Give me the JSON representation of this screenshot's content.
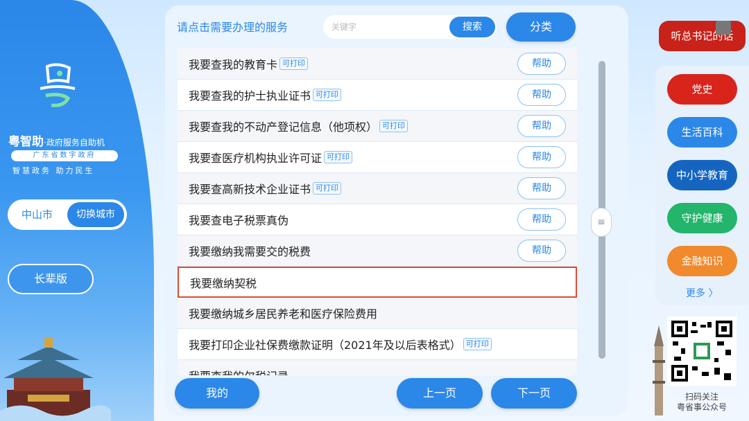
{
  "left": {
    "brand_name": "粤智助",
    "brand_sub": "·政府服务自助机",
    "brand_pill": "广东省数字政府",
    "brand_slogan": "智慧政务  助力民生",
    "city_name": "中山市",
    "city_switch_label": "切换城市",
    "elder_mode_label": "长辈版"
  },
  "main": {
    "prompt": "请点击需要办理的服务",
    "search_placeholder": "关键字",
    "search_label": "搜索",
    "category_label": "分类",
    "items": [
      {
        "label": "我要查我的教育卡",
        "tag": "可打印",
        "help": "帮助"
      },
      {
        "label": "我要查我的护士执业证书",
        "tag": "可打印",
        "help": "帮助"
      },
      {
        "label": "我要查我的不动产登记信息（他项权）",
        "tag": "可打印",
        "help": "帮助"
      },
      {
        "label": "我要查医疗机构执业许可证",
        "tag": "可打印",
        "help": "帮助"
      },
      {
        "label": "我要查高新技术企业证书",
        "tag": "可打印",
        "help": "帮助"
      },
      {
        "label": "我要查电子税票真伪",
        "tag": "",
        "help": "帮助"
      },
      {
        "label": "我要缴纳我需要交的税费",
        "tag": "",
        "help": "帮助"
      },
      {
        "label": "我要缴纳契税",
        "tag": "",
        "help": ""
      },
      {
        "label": "我要缴纳城乡居民养老和医疗保险费用",
        "tag": "",
        "help": ""
      },
      {
        "label": "我要打印企业社保费缴款证明（2021年及以后表格式）",
        "tag": "可打印",
        "help": ""
      },
      {
        "label": "我要查我的欠税记录",
        "tag": "",
        "help": ""
      }
    ],
    "mine_label": "我的",
    "prev_label": "上一页",
    "next_label": "下一页"
  },
  "right": {
    "talk_label": "听总书记的话",
    "menu": [
      {
        "label": "党史",
        "color": "#d9241c"
      },
      {
        "label": "生活百科",
        "color": "#2b87e8"
      },
      {
        "label": "中小学教育",
        "color": "#1565c0"
      },
      {
        "label": "守护健康",
        "color": "#22b56b"
      },
      {
        "label": "金融知识",
        "color": "#f08a2c"
      }
    ],
    "more_label": "更多 〉",
    "qr_caption_line1": "扫码关注",
    "qr_caption_line2": "粤省事公众号"
  },
  "colors": {
    "primary": "#2b87e8",
    "selected_border": "#e04a33",
    "party_red": "#c8221b"
  }
}
